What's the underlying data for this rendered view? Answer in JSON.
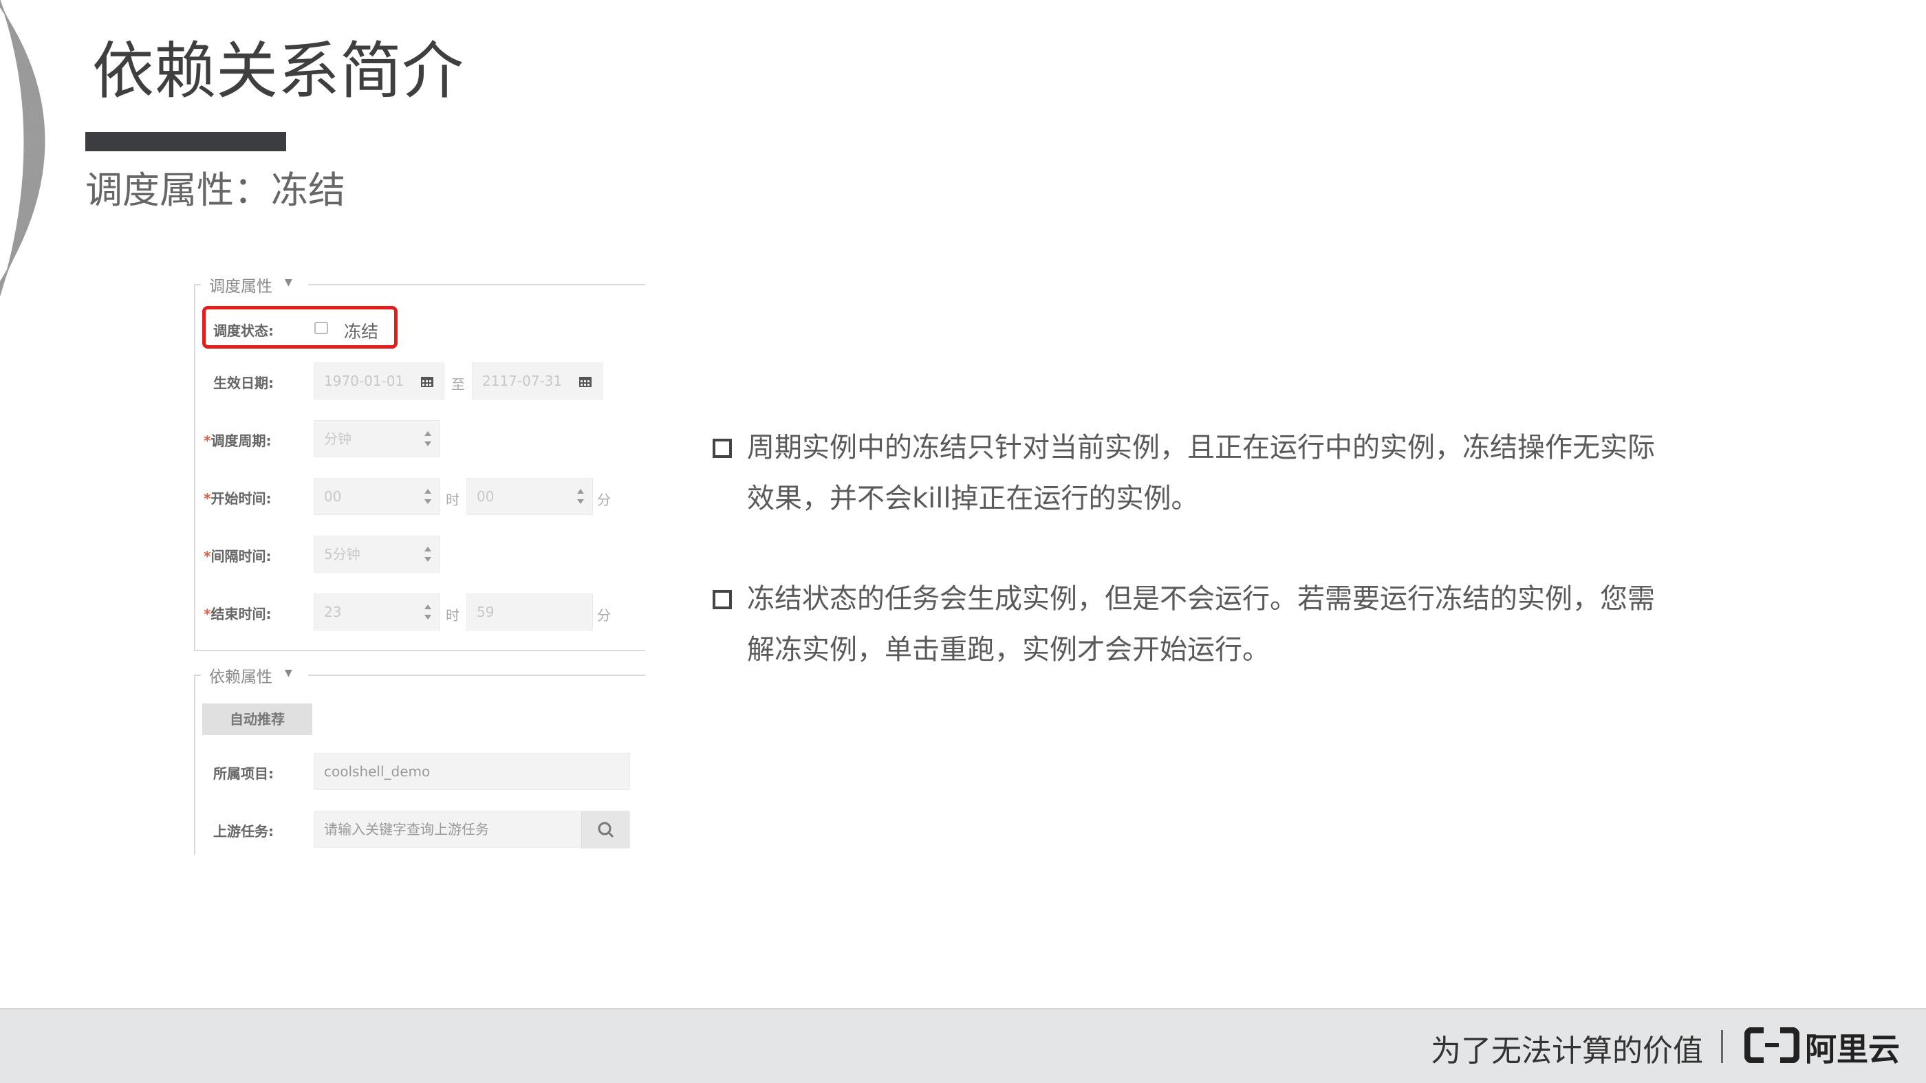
{
  "slide": {
    "title": "依赖关系简介",
    "subtitle": "调度属性：冻结"
  },
  "form": {
    "schedule_section": "调度属性",
    "status_label": "调度状态:",
    "freeze_label": "冻结",
    "freeze_checked": false,
    "effective_label": "生效日期:",
    "effective_start": "1970-01-01",
    "effective_to": "至",
    "effective_end": "2117-07-31",
    "cycle_label": "调度周期:",
    "cycle_value": "分钟",
    "start_label": "开始时间:",
    "start_hour": "00",
    "start_min": "00",
    "interval_label": "间隔时间:",
    "interval_value": "5分钟",
    "end_label": "结束时间:",
    "end_hour": "23",
    "end_min": "59",
    "hour_unit": "时",
    "min_unit": "分",
    "required_mark": "*",
    "dep_section": "依赖属性",
    "auto_recommend": "自动推荐",
    "project_label": "所属项目:",
    "project_value": "coolshell_demo",
    "upstream_label": "上游任务:",
    "upstream_placeholder": "请输入关键字查询上游任务"
  },
  "bullets": [
    "周期实例中的冻结只针对当前实例，且正在运行中的实例，冻结操作无实际效果，并不会kill掉正在运行的实例。",
    "冻结状态的任务会生成实例，但是不会运行。若需要运行冻结的实例，您需解冻实例，单击重跑，实例才会开始运行。"
  ],
  "footer": {
    "slogan": "为了无法计算的价值",
    "brand": "阿里云"
  },
  "icons": {
    "calendar": "calendar-icon",
    "spinner": "spinner-icon",
    "search": "search-icon",
    "logo": "aliyun-logo-icon"
  },
  "colors": {
    "highlight": "#e31c1c",
    "title_bar": "#3b3d41",
    "footer_bg": "#e4e5e6"
  }
}
